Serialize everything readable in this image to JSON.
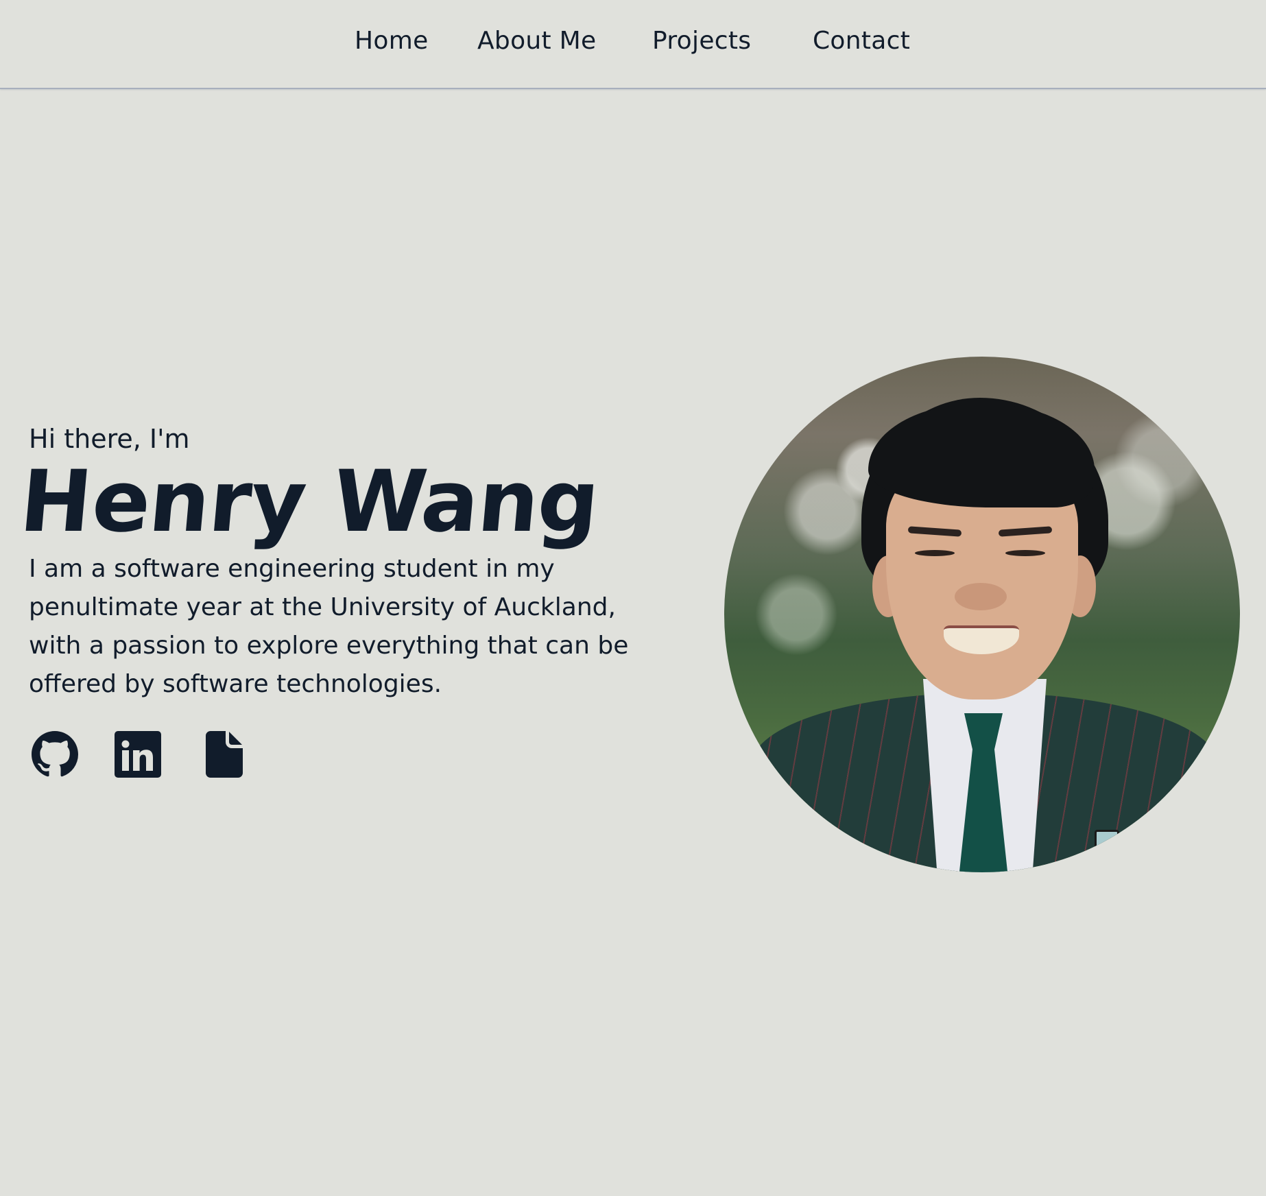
{
  "nav": {
    "items": [
      {
        "label": "Home"
      },
      {
        "label": "About Me"
      },
      {
        "label": "Projects"
      },
      {
        "label": "Contact"
      }
    ]
  },
  "hero": {
    "greeting": "Hi there, I'm",
    "name": "Henry Wang",
    "bio_lines": [
      "I am a software engineering student in my",
      "penultimate year at the University of Auckland,",
      "with a passion to explore everything that can be",
      "offered by software technologies."
    ],
    "socials": [
      {
        "icon": "github-icon",
        "label": "GitHub"
      },
      {
        "icon": "linkedin-icon",
        "label": "LinkedIn"
      },
      {
        "icon": "file-icon",
        "label": "Resume"
      }
    ],
    "portrait_alt": "Portrait photo of Henry Wang"
  },
  "colors": {
    "background": "#e0e1dc",
    "text": "#111c2b",
    "nav_border": "#a7afbd"
  }
}
